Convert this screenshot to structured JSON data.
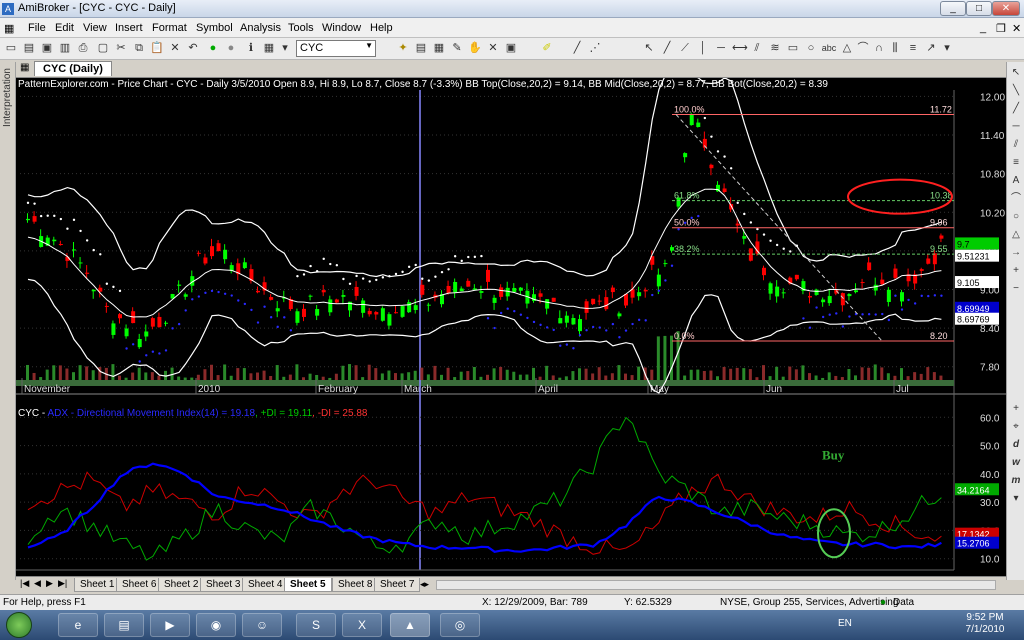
{
  "window": {
    "title": "AmiBroker - [CYC - CYC - Daily]",
    "app_icon": "amibroker-icon"
  },
  "menu": [
    "File",
    "Edit",
    "View",
    "Insert",
    "Format",
    "Symbol",
    "Analysis",
    "Tools",
    "Window",
    "Help"
  ],
  "toolbar": {
    "symbol": "CYC"
  },
  "side_tab": "Interpretation",
  "doc_tab": "CYC (Daily)",
  "price_pane": {
    "header": "PatternExplorer.com - Price Chart - CYC - Daily 3/5/2010 Open 8.9, Hi 8.9, Lo 8.7, Close 8.7 (-3.3%) BB Top(Close,20,2) = 9.14, BB Mid(Close,20,2) = 8.77, BB Bot(Close,20,2) = 8.39",
    "y_ticks": [
      "12.00",
      "11.40",
      "10.80",
      "10.20",
      "9.60",
      "9.00",
      "8.40",
      "7.80"
    ],
    "x_labels": [
      "November",
      "2010",
      "February",
      "March",
      "April",
      "May",
      "Jun",
      "Jul"
    ],
    "fib_labels": [
      "100.0%",
      "61.8%",
      "50.0%",
      "38.2%",
      "0.0%"
    ],
    "fib_values": [
      "11.72",
      "10.38",
      "9.96",
      "9.55",
      "8.20"
    ],
    "right_labels": [
      {
        "text": "9.7",
        "color": "#00cc00",
        "fg": "#000"
      },
      {
        "text": "9.51231",
        "color": "#ffffff",
        "fg": "#000"
      },
      {
        "text": "9.105",
        "color": "#ffffff",
        "fg": "#000"
      },
      {
        "text": "8.69949",
        "color": "#0000cc",
        "fg": "#fff"
      },
      {
        "text": "8.69769",
        "color": "#ffffff",
        "fg": "#000"
      }
    ]
  },
  "adx_pane": {
    "header_prefix": "CYC - ",
    "adx_text": "ADX - Directional Movement Index(14) = 19.18",
    "pdi_text": ", +DI = 19.11",
    "mdi_text": ", -DI = 25.88",
    "y_ticks": [
      "60.0",
      "50.0",
      "40.0",
      "30.0",
      "20.0",
      "10.0"
    ],
    "annotation": "Buy",
    "right_labels": [
      {
        "text": "34.2164",
        "color": "#00aa00",
        "fg": "#fff"
      },
      {
        "text": "17.1342",
        "color": "#cc0000",
        "fg": "#fff"
      },
      {
        "text": "15.2706",
        "color": "#0000cc",
        "fg": "#fff"
      }
    ]
  },
  "sheets": [
    "Sheet 1",
    "Sheet 6",
    "Sheet 2",
    "Sheet 3",
    "Sheet 4",
    "Sheet 5",
    "Sheet 8",
    "Sheet 7"
  ],
  "active_sheet": "Sheet 5",
  "status": {
    "help": "For Help, press F1",
    "coords": "X: 12/29/2009, Bar: 789",
    "yval": "Y: 62.5329",
    "info": "NYSE, Group 255, Services, Advertising",
    "data": "Data"
  },
  "taskbar": {
    "lang": "EN",
    "time": "9:52 PM",
    "date": "7/1/2010"
  },
  "colors": {
    "up": "#00ff00",
    "down": "#ff0000",
    "bb": "#ffffff",
    "adx": "#0000ff",
    "pdi": "#00aa00",
    "mdi": "#cc0000",
    "fib": "#ff6666",
    "cursor": "#8888ff"
  }
}
